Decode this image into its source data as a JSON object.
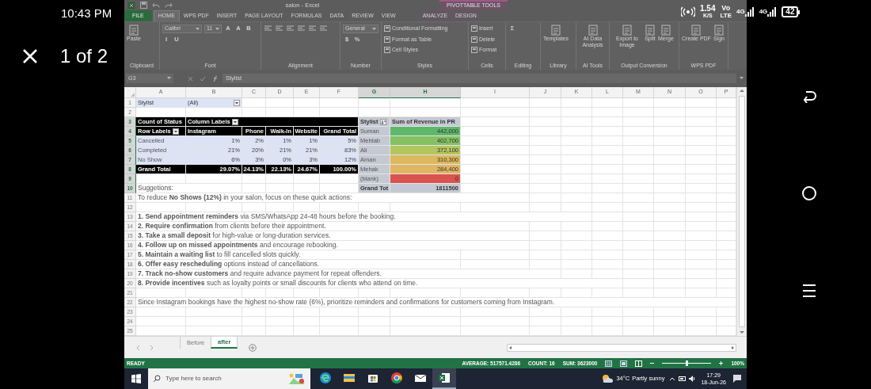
{
  "device_status": {
    "time": "10:43 PM",
    "speed": "1.54",
    "speed_unit": "K/S",
    "volte_top": "Vo",
    "volte_bottom": "LTE",
    "network": "4G",
    "network_2": "4G",
    "battery": "42"
  },
  "viewer": {
    "counter": "1 of 2"
  },
  "excel": {
    "title": "salon - Excel",
    "context_tab_group": "PIVOTTABLE TOOLS",
    "tabs": [
      {
        "label": "FILE",
        "kind": "file",
        "selected": false
      },
      {
        "label": "HOME",
        "kind": "normal",
        "selected": true
      },
      {
        "label": "WPS PDF",
        "kind": "normal",
        "selected": false
      },
      {
        "label": "INSERT",
        "kind": "normal",
        "selected": false
      },
      {
        "label": "PAGE LAYOUT",
        "kind": "normal",
        "selected": false
      },
      {
        "label": "FORMULAS",
        "kind": "normal",
        "selected": false
      },
      {
        "label": "DATA",
        "kind": "normal",
        "selected": false
      },
      {
        "label": "REVIEW",
        "kind": "normal",
        "selected": false
      },
      {
        "label": "VIEW",
        "kind": "normal",
        "selected": false
      },
      {
        "label": "ANALYZE",
        "kind": "context",
        "selected": false
      },
      {
        "label": "DESIGN",
        "kind": "context",
        "selected": false
      }
    ],
    "ribbon_groups": [
      {
        "label": "Clipboard",
        "items": [
          {
            "kind": "large",
            "label": "Paste"
          }
        ]
      },
      {
        "label": "Font",
        "items": [
          {
            "kind": "field",
            "label": "Calibri"
          },
          {
            "kind": "field",
            "label": "11"
          },
          {
            "kind": "glyph",
            "label": "A"
          },
          {
            "kind": "glyph",
            "label": "A"
          },
          {
            "kind": "glyph",
            "label": "B"
          },
          {
            "kind": "glyph",
            "label": "I"
          },
          {
            "kind": "glyph",
            "label": "U"
          }
        ]
      },
      {
        "label": "Alignment"
      },
      {
        "label": "Number",
        "items": [
          {
            "kind": "field",
            "label": "General"
          },
          {
            "kind": "glyph",
            "label": "$"
          },
          {
            "kind": "glyph",
            "label": "%"
          }
        ]
      },
      {
        "label": "Styles",
        "items": [
          {
            "kind": "small",
            "label": "Conditional Formatting"
          },
          {
            "kind": "small",
            "label": "Format as Table"
          },
          {
            "kind": "small",
            "label": "Cell Styles"
          }
        ]
      },
      {
        "label": "Cells",
        "items": [
          {
            "kind": "small",
            "label": "Insert"
          },
          {
            "kind": "small",
            "label": "Delete"
          },
          {
            "kind": "small",
            "label": "Format"
          }
        ]
      },
      {
        "label": "Editing",
        "items": [
          {
            "kind": "glyph",
            "label": "Σ"
          }
        ]
      },
      {
        "label": "Library",
        "items": [
          {
            "kind": "large",
            "label": "Templates"
          }
        ]
      },
      {
        "label": "AI Tools",
        "items": [
          {
            "kind": "large",
            "label": "AI Data Analysis"
          }
        ]
      },
      {
        "label": "Output Conversion",
        "items": [
          {
            "kind": "large",
            "label": "Export to Image"
          },
          {
            "kind": "large",
            "label": "Split"
          },
          {
            "kind": "large",
            "label": "Merge"
          }
        ]
      },
      {
        "label": "WPS PDF",
        "items": [
          {
            "kind": "large",
            "label": "Create PDF"
          },
          {
            "kind": "large",
            "label": "Sign"
          }
        ]
      }
    ],
    "name_box": "G3",
    "formula": "Stylist",
    "columns": [
      {
        "label": "A",
        "selected": false
      },
      {
        "label": "B",
        "selected": false
      },
      {
        "label": "C",
        "selected": false
      },
      {
        "label": "D",
        "selected": false
      },
      {
        "label": "E",
        "selected": false
      },
      {
        "label": "F",
        "selected": false
      },
      {
        "label": "G",
        "selected": true
      },
      {
        "label": "H",
        "selected": true
      },
      {
        "label": "I",
        "selected": false
      },
      {
        "label": "J",
        "selected": false
      },
      {
        "label": "K",
        "selected": false
      },
      {
        "label": "L",
        "selected": false
      },
      {
        "label": "M",
        "selected": false
      },
      {
        "label": "N",
        "selected": false
      },
      {
        "label": "O",
        "selected": false
      },
      {
        "label": "P",
        "selected": false
      }
    ],
    "rows": [
      {
        "number": "1",
        "selected": false
      },
      {
        "number": "2",
        "selected": false
      },
      {
        "number": "3",
        "selected": true
      },
      {
        "number": "4",
        "selected": true
      },
      {
        "number": "5",
        "selected": true
      },
      {
        "number": "6",
        "selected": true
      },
      {
        "number": "7",
        "selected": true
      },
      {
        "number": "8",
        "selected": true
      },
      {
        "number": "9",
        "selected": true
      },
      {
        "number": "10",
        "selected": true
      },
      {
        "number": "11",
        "selected": false
      },
      {
        "number": "12",
        "selected": false
      },
      {
        "number": "13",
        "selected": false
      },
      {
        "number": "14",
        "selected": false
      },
      {
        "number": "15",
        "selected": false
      },
      {
        "number": "16",
        "selected": false
      },
      {
        "number": "17",
        "selected": false
      },
      {
        "number": "18",
        "selected": false
      },
      {
        "number": "19",
        "selected": false
      },
      {
        "number": "20",
        "selected": false
      },
      {
        "number": "21",
        "selected": false
      },
      {
        "number": "22",
        "selected": false
      },
      {
        "number": "23",
        "selected": false
      },
      {
        "number": "24",
        "selected": false
      },
      {
        "number": "25",
        "selected": false
      }
    ],
    "sheet": {
      "report_filter": {
        "label": "Stylist",
        "value": "(All)",
        "dropdown": true
      },
      "pivot": {
        "value_field": "Count of Status",
        "column_labels": "Column Labels",
        "column_labels_dropdown": true,
        "row_labels": "Row Labels",
        "row_labels_dropdown": true,
        "columns": [
          "Instagram",
          "Phone",
          "Walk-In",
          "Website",
          "Grand Total"
        ],
        "rows": [
          {
            "label": "Cancelled",
            "values": [
              "1%",
              "2%",
              "1%",
              "1%",
              "5%"
            ]
          },
          {
            "label": "Completed",
            "values": [
              "21%",
              "20%",
              "21%",
              "21%",
              "83%"
            ]
          },
          {
            "label": "No Show",
            "values": [
              "6%",
              "3%",
              "0%",
              "3%",
              "12%"
            ]
          }
        ],
        "grand_total": {
          "label": "Grand Total",
          "values": [
            "29.07%",
            "24.13%",
            "22.13%",
            "24.67%",
            "100.00%"
          ]
        }
      },
      "summary": {
        "row_field": "Stylist",
        "sorted": true,
        "value_field": "Sum of Revenue in PR",
        "rows": [
          {
            "label": "Suman",
            "value": "442,000",
            "color": "#5fb86a"
          },
          {
            "label": "Mehtab",
            "value": "402,700",
            "color": "#85c063"
          },
          {
            "label": "Ali",
            "value": "372,100",
            "color": "#b3c65e"
          },
          {
            "label": "Aman",
            "value": "310,300",
            "color": "#dcb95e"
          },
          {
            "label": "Mehak",
            "value": "284,400",
            "color": "#e0b663"
          },
          {
            "label": "(blank)",
            "value": "0",
            "color": "#d9534f"
          }
        ],
        "grand_total": {
          "label": "Grand Tot",
          "value": "1811500"
        }
      },
      "notes": [
        "Suggetions:",
        "To reduce **No Shows (12%)** in your salon, focus on these quick actions:",
        "  **1. Send appointment reminders** via SMS/WhatsApp 24-48 hours before the booking.",
        "  **2. Require confirmation** from clients before their appointment.",
        "  **3. Take a small deposit** for high-value or long-duration services.",
        "  **4. Follow up on missed appointments** and encourage rebooking.",
        "  **5. Maintain a waiting list** to fill cancelled slots quickly.",
        "  **6. Offer easy rescheduling** options instead of cancellations.",
        "  **7. Track no-show customers** and require advance payment for repeat offenders.",
        "  **8. Provide incentives** such as loyalty points or small discounts for clients who attend on time.",
        "Since Instagram bookings have the highest no-show rate (6%), prioritize reminders and confirmations for customers coming from Instagram."
      ]
    },
    "sheet_tabs": [
      {
        "label": "Before",
        "selected": false
      },
      {
        "label": "after",
        "selected": true
      }
    ],
    "status_bar": {
      "mode": "READY",
      "average": "AVERAGE: 517571.4286",
      "count": "COUNT: 16",
      "sum": "SUM: 3623000",
      "zoom": "100%",
      "zoom_slider": {
        "level": 0.5
      }
    }
  },
  "taskbar": {
    "search_placeholder": "Type here to search",
    "apps": [
      {
        "kind": "edge",
        "selected": false
      },
      {
        "kind": "folder",
        "selected": false
      },
      {
        "kind": "store",
        "selected": false
      },
      {
        "kind": "chrome",
        "selected": false
      },
      {
        "kind": "mail",
        "selected": false
      },
      {
        "kind": "excel",
        "selected": true
      }
    ],
    "weather_temp": "34°C",
    "weather_text": "Partly sunny",
    "time": "17:29",
    "date": "18-Jun-26"
  }
}
